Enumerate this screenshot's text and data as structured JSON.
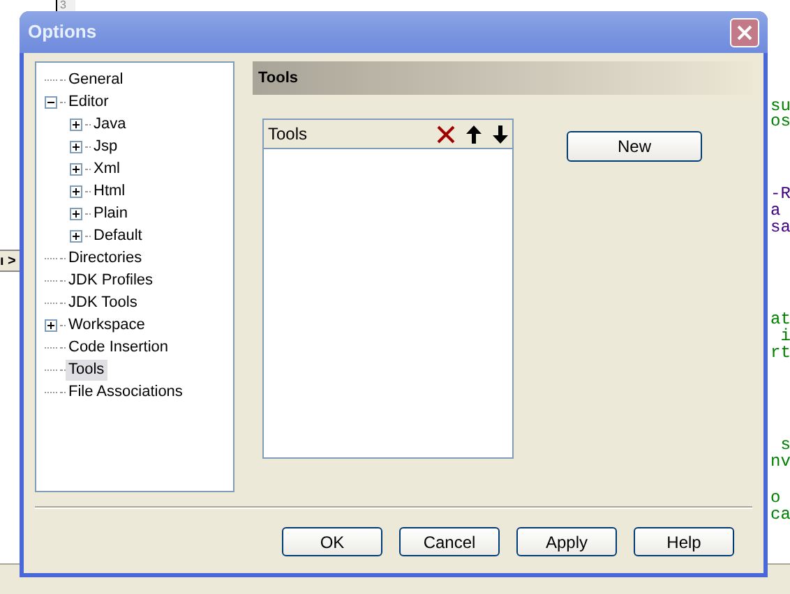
{
  "editor": {
    "line_number": "3",
    "side_tab": "ı >",
    "code_lines": [
      {
        "text": "su",
        "color": "#008000"
      },
      {
        "text": "os",
        "color": "#008000"
      },
      {
        "text": "-R",
        "color": "#400080"
      },
      {
        "text": "a",
        "color": "#400080"
      },
      {
        "text": "sa",
        "color": "#400080"
      },
      {
        "text": "at",
        "color": "#008000"
      },
      {
        "text": " i",
        "color": "#008000"
      },
      {
        "text": "rt",
        "color": "#008000"
      },
      {
        "text": " s",
        "color": "#008000"
      },
      {
        "text": "nv",
        "color": "#008000"
      },
      {
        "text": "o",
        "color": "#008000"
      },
      {
        "text": "ca",
        "color": "#008000"
      }
    ]
  },
  "window": {
    "title": "Options"
  },
  "tree": [
    {
      "label": "General",
      "selected": false
    },
    {
      "label": "Editor",
      "selected": false,
      "expanded": true,
      "children": [
        {
          "label": "Java",
          "selected": false,
          "expanded": false
        },
        {
          "label": "Jsp",
          "selected": false,
          "expanded": false
        },
        {
          "label": "Xml",
          "selected": false,
          "expanded": false
        },
        {
          "label": "Html",
          "selected": false,
          "expanded": false
        },
        {
          "label": "Plain",
          "selected": false,
          "expanded": false
        },
        {
          "label": "Default",
          "selected": false,
          "expanded": false
        }
      ]
    },
    {
      "label": "Directories",
      "selected": false
    },
    {
      "label": "JDK Profiles",
      "selected": false
    },
    {
      "label": "JDK Tools",
      "selected": false
    },
    {
      "label": "Workspace",
      "selected": false,
      "expanded": false
    },
    {
      "label": "Code Insertion",
      "selected": false
    },
    {
      "label": "Tools",
      "selected": true
    },
    {
      "label": "File Associations",
      "selected": false
    }
  ],
  "panel": {
    "title": "Tools",
    "list_header": "Tools",
    "new_button": "New"
  },
  "buttons": [
    "OK",
    "Cancel",
    "Apply",
    "Help"
  ]
}
